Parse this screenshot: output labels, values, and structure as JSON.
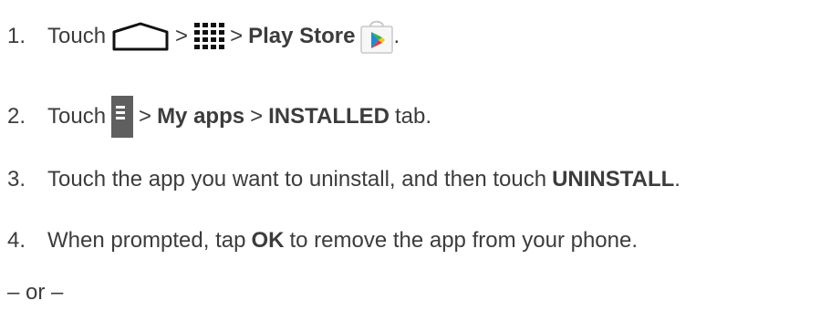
{
  "steps": [
    {
      "number": "1.",
      "touch": "Touch",
      "sep1": ">",
      "sep2": ">",
      "play_store": "Play Store",
      "end": "."
    },
    {
      "number": "2.",
      "touch": "Touch",
      "sep1": ">",
      "my_apps": "My apps",
      "sep2": ">",
      "installed": "INSTALLED",
      "tab": "tab."
    },
    {
      "number": "3.",
      "text": "Touch the app you want to uninstall, and then touch",
      "uninstall": "UNINSTALL",
      "end": "."
    },
    {
      "number": "4.",
      "before": "When prompted, tap",
      "ok": "OK",
      "after": "to remove the app from your phone."
    }
  ],
  "alternate": "– or –",
  "icons": {
    "home": "home-icon",
    "apps": "apps-grid-icon",
    "store": "play-store-icon",
    "menu": "menu-icon"
  },
  "colors": {
    "text": "#3c3c3c",
    "menu_bg": "#5f5f5f",
    "play_green": "#3ab34a",
    "play_blue": "#1f8ad6",
    "play_red": "#e53935",
    "play_yellow": "#f8c21a"
  }
}
